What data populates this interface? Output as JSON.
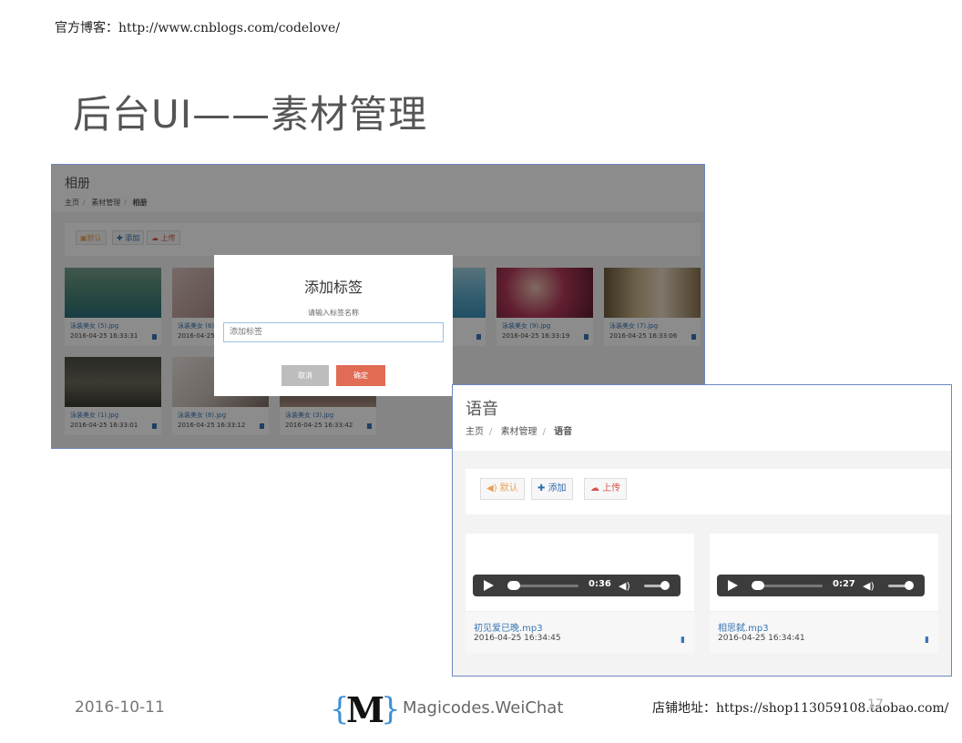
{
  "header": {
    "blog_line": "官方博客：http://www.cnblogs.com/codelove/"
  },
  "slide_title": "后台UI——素材管理",
  "album": {
    "title": "相册",
    "breadcrumb": [
      "主页",
      "素材管理",
      "相册"
    ],
    "toolbar": {
      "default_label": "默认",
      "add_label": "添加",
      "upload_label": "上传"
    },
    "photos": [
      {
        "name": "泳装美女 (5).jpg",
        "time": "2016-04-25 16:33:31"
      },
      {
        "name": "泳装美女 (6).jpg",
        "time": "2016-04-25 16:33:"
      },
      {
        "name": "",
        "time": ""
      },
      {
        "name": "",
        "time": ""
      },
      {
        "name": "泳装美女 (9).jpg",
        "time": "2016-04-25 16:33:19"
      },
      {
        "name": "泳装美女 (7).jpg",
        "time": "2016-04-25 16:33:06"
      },
      {
        "name": "泳装美女 (1).jpg",
        "time": "2016-04-25 16:33:01"
      },
      {
        "name": "泳装美女 (8).jpg",
        "time": "2016-04-25 16:33:12"
      },
      {
        "name": "泳装美女 (3).jpg",
        "time": "2016-04-25 16:33:42"
      }
    ],
    "modal": {
      "title": "添加标签",
      "label": "请输入标签名称",
      "placeholder": "添加标签",
      "cancel": "取消",
      "confirm": "确定"
    }
  },
  "voice": {
    "title": "语音",
    "breadcrumb": [
      "主页",
      "素材管理",
      "语音"
    ],
    "toolbar": {
      "default_label": "默认",
      "add_label": "添加",
      "upload_label": "上传"
    },
    "items": [
      {
        "name": "初见爱已晚.mp3",
        "time": "2016-04-25 16:34:45",
        "duration": "0:36"
      },
      {
        "name": "相思弑.mp3",
        "time": "2016-04-25 16:34:41",
        "duration": "0:27"
      }
    ]
  },
  "footer": {
    "date": "2016-10-11",
    "logo_text": "Magicodes.WeiChat",
    "shop": "店铺地址：https://shop113059108.taobao.com/",
    "page_number": "17"
  },
  "colors": {
    "accent_red": "#e16c55",
    "link_blue": "#3a75b5",
    "border_blue": "#6e86c0"
  }
}
